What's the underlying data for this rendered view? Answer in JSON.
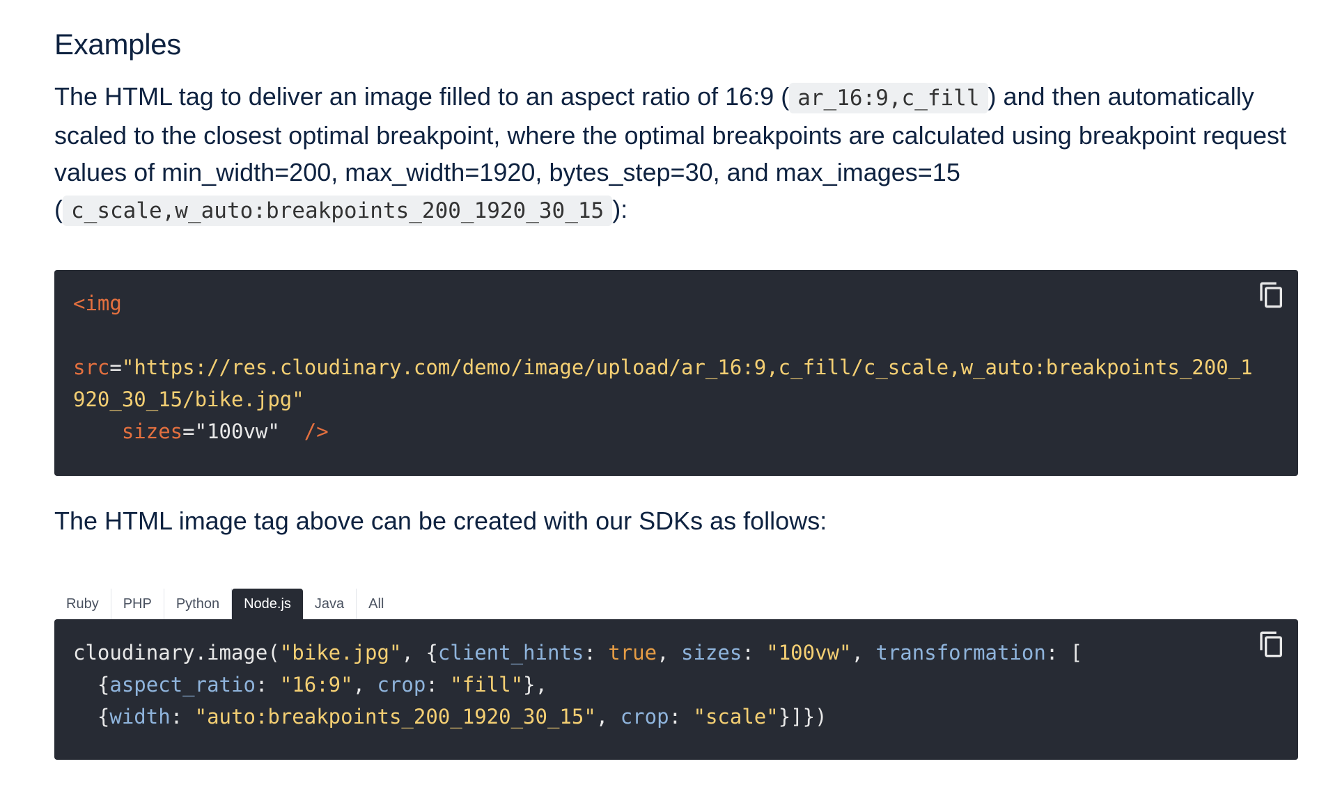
{
  "heading": "Examples",
  "intro": {
    "part1": "The HTML tag to deliver an image filled to an aspect ratio of 16:9 (",
    "code1": "ar_16:9,c_fill",
    "part2": ") and then automatically scaled to the closest optimal breakpoint, where the optimal breakpoints are calculated using breakpoint request values of min_width=200, max_width=1920, bytes_step=30, and max_images=15 (",
    "code2": "c_scale,w_auto:breakpoints_200_1920_30_15",
    "part3": "):"
  },
  "html_code": {
    "open_tag": "<img",
    "src_attr": "src",
    "src_value_line1": "\"https://res.cloudinary.com/demo/image/upload/ar_16:9,c_fill/c_scale,w_auto:breakpoints_200_1",
    "src_value_line2": "920_30_15/bike.jpg\"",
    "sizes_attr": "sizes",
    "sizes_value": "\"100vw\"",
    "close_tag": "/>",
    "copy_icon": "copy-icon"
  },
  "para2": "The HTML image tag above can be created with our SDKs as follows:",
  "tabs": [
    "Ruby",
    "PHP",
    "Python",
    "Node.js",
    "Java",
    "All"
  ],
  "active_tab": "Node.js",
  "sdk_code": {
    "l1_fn": "cloudinary.image(",
    "l1_str": "\"bike.jpg\"",
    "l1_sep": ", {",
    "l1_k1": "client_hints",
    "l1_c1": ": ",
    "l1_v1": "true",
    "l1_sep2": ", ",
    "l1_k2": "sizes",
    "l1_c2": ": ",
    "l1_v2": "\"100vw\"",
    "l1_sep3": ", ",
    "l1_k3": "transformation",
    "l1_end": ": [",
    "l2_open": "  {",
    "l2_k1": "aspect_ratio",
    "l2_c1": ": ",
    "l2_v1": "\"16:9\"",
    "l2_sep": ", ",
    "l2_k2": "crop",
    "l2_c2": ": ",
    "l2_v2": "\"fill\"",
    "l2_end": "},",
    "l3_open": "  {",
    "l3_k1": "width",
    "l3_c1": ": ",
    "l3_v1": "\"auto:breakpoints_200_1920_30_15\"",
    "l3_sep": ", ",
    "l3_k2": "crop",
    "l3_c2": ": ",
    "l3_v2": "\"scale\"",
    "l3_end": "}]})",
    "copy_icon": "copy-icon"
  }
}
